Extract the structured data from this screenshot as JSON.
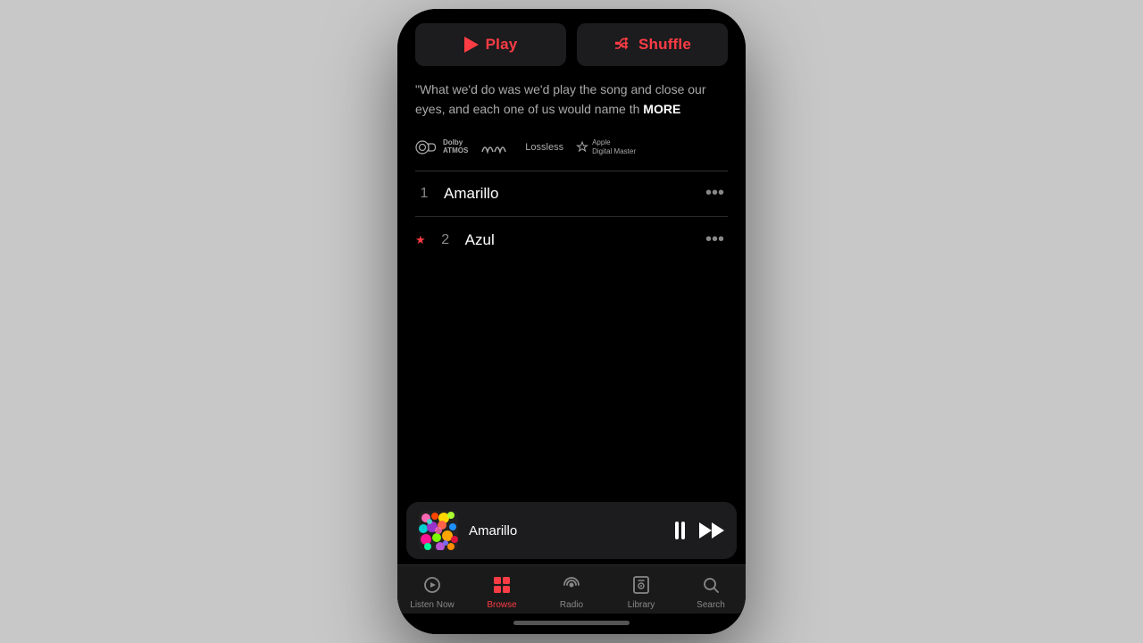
{
  "buttons": {
    "play_label": "Play",
    "shuffle_label": "Shuffle"
  },
  "quote": {
    "text": "\"What we'd do was we'd play the song and close our eyes, and each one of us would name th",
    "more_label": "MORE"
  },
  "badges": [
    {
      "id": "dolby",
      "line1": "Dolby",
      "line2": "ATMOS"
    },
    {
      "id": "lossless",
      "label": "Lossless"
    },
    {
      "id": "adm",
      "line1": "Apple",
      "line2": "Digital Master"
    }
  ],
  "tracks": [
    {
      "num": "1",
      "star": false,
      "name": "Amarillo",
      "id": "track-1"
    },
    {
      "num": "2",
      "star": true,
      "name": "Azul",
      "id": "track-2"
    }
  ],
  "now_playing": {
    "title": "Amarillo"
  },
  "tabs": [
    {
      "id": "listen-now",
      "label": "Listen Now",
      "active": false
    },
    {
      "id": "browse",
      "label": "Browse",
      "active": true
    },
    {
      "id": "radio",
      "label": "Radio",
      "active": false
    },
    {
      "id": "library",
      "label": "Library",
      "active": false
    },
    {
      "id": "search",
      "label": "Search",
      "active": false
    }
  ]
}
